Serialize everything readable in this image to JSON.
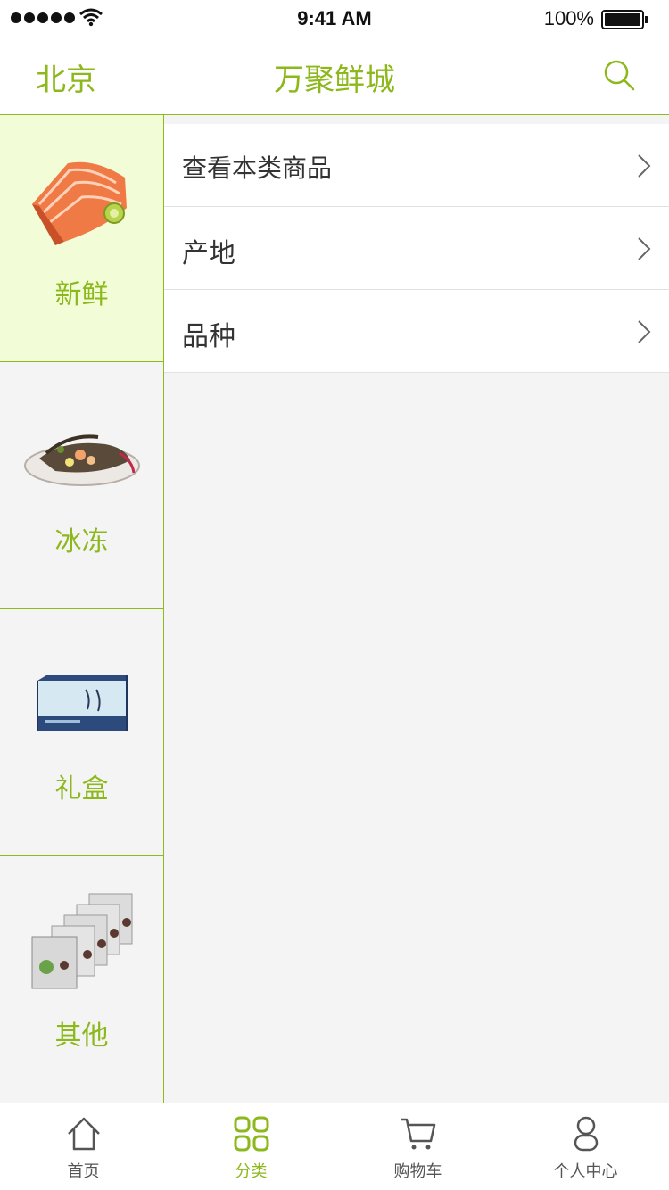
{
  "status_bar": {
    "time": "9:41 AM",
    "battery": "100%",
    "battery_level": 1.0
  },
  "nav": {
    "city": "北京",
    "title": "万聚鲜城",
    "search_icon": "search-icon"
  },
  "sidebar": {
    "items": [
      {
        "label": "新鲜",
        "image": "salmon-image",
        "active": true
      },
      {
        "label": "冰冻",
        "image": "seafood-platter-image",
        "active": false
      },
      {
        "label": "礼盒",
        "image": "gift-box-image",
        "active": false
      },
      {
        "label": "其他",
        "image": "packaged-goods-image",
        "active": false
      }
    ]
  },
  "content": {
    "rows": [
      {
        "label": "查看本类商品"
      },
      {
        "label": "产地"
      },
      {
        "label": "品种"
      }
    ]
  },
  "tabs": [
    {
      "label": "首页",
      "icon": "home-icon",
      "active": false
    },
    {
      "label": "分类",
      "icon": "category-icon",
      "active": true
    },
    {
      "label": "购物车",
      "icon": "cart-icon",
      "active": false
    },
    {
      "label": "个人中心",
      "icon": "user-icon",
      "active": false
    }
  ],
  "colors": {
    "accent": "#8cb81c",
    "active_bg": "#f2fcd6",
    "bg": "#f4f4f4"
  }
}
